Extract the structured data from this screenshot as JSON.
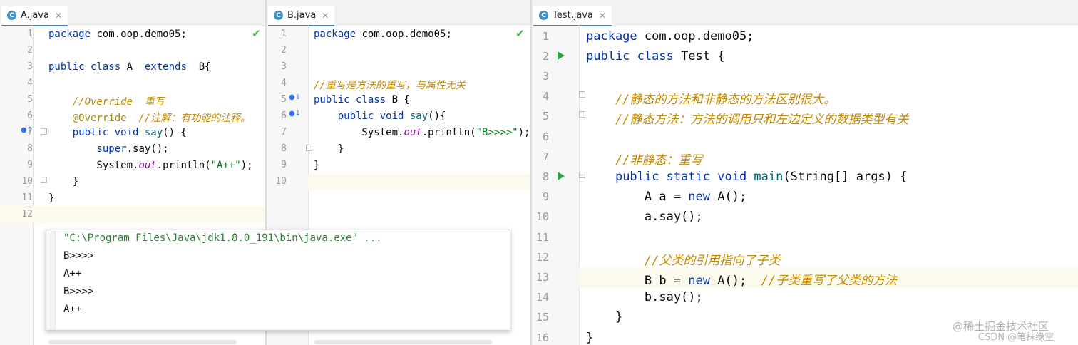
{
  "panes": {
    "a": {
      "tab": "A.java",
      "lines": [
        [
          {
            "t": "package com.oop.demo05;",
            "c": "kw-mix-pkg"
          }
        ],
        [],
        [
          {
            "t": "public class ",
            "c": "kw"
          },
          {
            "t": "A  ",
            "c": ""
          },
          {
            "t": "extends",
            "c": "kw"
          },
          {
            "t": "  B{",
            "c": ""
          }
        ],
        [],
        [
          {
            "t": "    //Override  重写",
            "c": "cmz"
          }
        ],
        [
          {
            "t": "    @Override",
            "c": "an"
          },
          {
            "t": "  //注解：有功能的注释。",
            "c": "cmz"
          }
        ],
        [
          {
            "t": "    ",
            "c": ""
          },
          {
            "t": "public void ",
            "c": "kw"
          },
          {
            "t": "say",
            "c": "fn"
          },
          {
            "t": "() {",
            "c": ""
          }
        ],
        [
          {
            "t": "        ",
            "c": ""
          },
          {
            "t": "super",
            "c": "kw"
          },
          {
            "t": ".say();",
            "c": ""
          }
        ],
        [
          {
            "t": "        System.",
            "c": ""
          },
          {
            "t": "out",
            "c": "it"
          },
          {
            "t": ".println(",
            "c": ""
          },
          {
            "t": "\"A++\"",
            "c": "st"
          },
          {
            "t": ");",
            "c": ""
          }
        ],
        [
          {
            "t": "    }",
            "c": ""
          }
        ],
        [
          {
            "t": "}",
            "c": ""
          }
        ],
        []
      ]
    },
    "b": {
      "tab": "B.java",
      "lines": [
        [
          {
            "t": "package com.oop.demo05;",
            "c": "kw-mix-pkg"
          }
        ],
        [],
        [],
        [
          {
            "t": "//重写是方法的重写，与属性无关",
            "c": "cmz"
          }
        ],
        [
          {
            "t": "public class ",
            "c": "kw"
          },
          {
            "t": "B {",
            "c": ""
          }
        ],
        [
          {
            "t": "    ",
            "c": ""
          },
          {
            "t": "public void ",
            "c": "kw"
          },
          {
            "t": "say",
            "c": "fn"
          },
          {
            "t": "(){",
            "c": ""
          }
        ],
        [
          {
            "t": "        System.",
            "c": ""
          },
          {
            "t": "out",
            "c": "it"
          },
          {
            "t": ".println(",
            "c": ""
          },
          {
            "t": "\"B>>>>\"",
            "c": "st"
          },
          {
            "t": ");",
            "c": ""
          }
        ],
        [
          {
            "t": "    }",
            "c": ""
          }
        ],
        [
          {
            "t": "}",
            "c": ""
          }
        ],
        []
      ]
    },
    "t": {
      "tab": "Test.java",
      "lines": [
        [
          {
            "t": "package com.oop.demo05;",
            "c": "kw-mix-pkg"
          }
        ],
        [
          {
            "t": "public class ",
            "c": "kw"
          },
          {
            "t": "Test {",
            "c": ""
          }
        ],
        [],
        [
          {
            "t": "    //静态的方法和非静态的方法区别很大。",
            "c": "cmz"
          }
        ],
        [
          {
            "t": "    //静态方法：方法的调用只和左边定义的数据类型有关",
            "c": "cmz"
          }
        ],
        [],
        [
          {
            "t": "    //非静态：重写",
            "c": "cmz"
          }
        ],
        [
          {
            "t": "    ",
            "c": ""
          },
          {
            "t": "public static void ",
            "c": "kw"
          },
          {
            "t": "main",
            "c": "fn"
          },
          {
            "t": "(String[] args) {",
            "c": ""
          }
        ],
        [
          {
            "t": "        A a = ",
            "c": ""
          },
          {
            "t": "new ",
            "c": "kw"
          },
          {
            "t": "A();",
            "c": ""
          }
        ],
        [
          {
            "t": "        a.say();",
            "c": ""
          }
        ],
        [],
        [
          {
            "t": "        //父类的引用指向了子类",
            "c": "cmz"
          }
        ],
        [
          {
            "t": "        B b = ",
            "c": ""
          },
          {
            "t": "new ",
            "c": "kw"
          },
          {
            "t": "A();",
            "c": ""
          },
          {
            "t": "  //子类重写了父类的方法",
            "c": "cmz"
          }
        ],
        [
          {
            "t": "        b.say();",
            "c": ""
          }
        ],
        [
          {
            "t": "    }",
            "c": ""
          }
        ],
        [
          {
            "t": "}",
            "c": ""
          }
        ]
      ]
    }
  },
  "console": {
    "lines": [
      "\"C:\\Program Files\\Java\\jdk1.8.0_191\\bin\\java.exe\" ...",
      "B>>>>",
      "A++",
      "B>>>>",
      "A++"
    ]
  },
  "watermark": {
    "main": "@稀土掘金技术社区",
    "sub": "CSDN @笔抹缘空"
  }
}
